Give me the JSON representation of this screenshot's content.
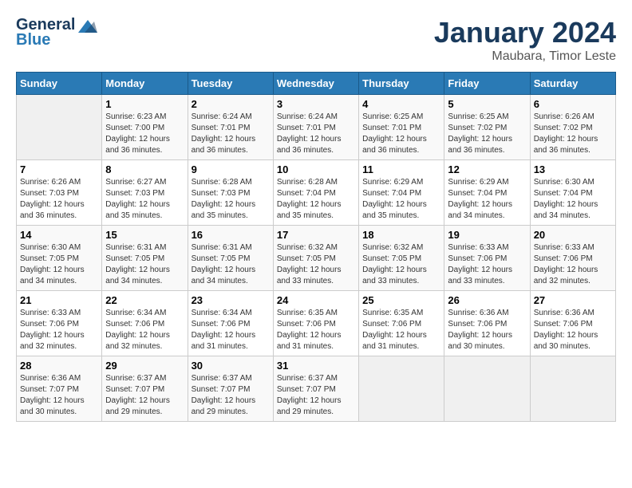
{
  "header": {
    "logo": {
      "line1": "General",
      "line2": "Blue",
      "tagline": "GeneralBlue"
    },
    "title": "January 2024",
    "subtitle": "Maubara, Timor Leste"
  },
  "columns": [
    "Sunday",
    "Monday",
    "Tuesday",
    "Wednesday",
    "Thursday",
    "Friday",
    "Saturday"
  ],
  "weeks": [
    [
      {
        "day": "",
        "info": ""
      },
      {
        "day": "1",
        "info": "Sunrise: 6:23 AM\nSunset: 7:00 PM\nDaylight: 12 hours\nand 36 minutes."
      },
      {
        "day": "2",
        "info": "Sunrise: 6:24 AM\nSunset: 7:01 PM\nDaylight: 12 hours\nand 36 minutes."
      },
      {
        "day": "3",
        "info": "Sunrise: 6:24 AM\nSunset: 7:01 PM\nDaylight: 12 hours\nand 36 minutes."
      },
      {
        "day": "4",
        "info": "Sunrise: 6:25 AM\nSunset: 7:01 PM\nDaylight: 12 hours\nand 36 minutes."
      },
      {
        "day": "5",
        "info": "Sunrise: 6:25 AM\nSunset: 7:02 PM\nDaylight: 12 hours\nand 36 minutes."
      },
      {
        "day": "6",
        "info": "Sunrise: 6:26 AM\nSunset: 7:02 PM\nDaylight: 12 hours\nand 36 minutes."
      }
    ],
    [
      {
        "day": "7",
        "info": "Sunrise: 6:26 AM\nSunset: 7:03 PM\nDaylight: 12 hours\nand 36 minutes."
      },
      {
        "day": "8",
        "info": "Sunrise: 6:27 AM\nSunset: 7:03 PM\nDaylight: 12 hours\nand 35 minutes."
      },
      {
        "day": "9",
        "info": "Sunrise: 6:28 AM\nSunset: 7:03 PM\nDaylight: 12 hours\nand 35 minutes."
      },
      {
        "day": "10",
        "info": "Sunrise: 6:28 AM\nSunset: 7:04 PM\nDaylight: 12 hours\nand 35 minutes."
      },
      {
        "day": "11",
        "info": "Sunrise: 6:29 AM\nSunset: 7:04 PM\nDaylight: 12 hours\nand 35 minutes."
      },
      {
        "day": "12",
        "info": "Sunrise: 6:29 AM\nSunset: 7:04 PM\nDaylight: 12 hours\nand 34 minutes."
      },
      {
        "day": "13",
        "info": "Sunrise: 6:30 AM\nSunset: 7:04 PM\nDaylight: 12 hours\nand 34 minutes."
      }
    ],
    [
      {
        "day": "14",
        "info": "Sunrise: 6:30 AM\nSunset: 7:05 PM\nDaylight: 12 hours\nand 34 minutes."
      },
      {
        "day": "15",
        "info": "Sunrise: 6:31 AM\nSunset: 7:05 PM\nDaylight: 12 hours\nand 34 minutes."
      },
      {
        "day": "16",
        "info": "Sunrise: 6:31 AM\nSunset: 7:05 PM\nDaylight: 12 hours\nand 34 minutes."
      },
      {
        "day": "17",
        "info": "Sunrise: 6:32 AM\nSunset: 7:05 PM\nDaylight: 12 hours\nand 33 minutes."
      },
      {
        "day": "18",
        "info": "Sunrise: 6:32 AM\nSunset: 7:05 PM\nDaylight: 12 hours\nand 33 minutes."
      },
      {
        "day": "19",
        "info": "Sunrise: 6:33 AM\nSunset: 7:06 PM\nDaylight: 12 hours\nand 33 minutes."
      },
      {
        "day": "20",
        "info": "Sunrise: 6:33 AM\nSunset: 7:06 PM\nDaylight: 12 hours\nand 32 minutes."
      }
    ],
    [
      {
        "day": "21",
        "info": "Sunrise: 6:33 AM\nSunset: 7:06 PM\nDaylight: 12 hours\nand 32 minutes."
      },
      {
        "day": "22",
        "info": "Sunrise: 6:34 AM\nSunset: 7:06 PM\nDaylight: 12 hours\nand 32 minutes."
      },
      {
        "day": "23",
        "info": "Sunrise: 6:34 AM\nSunset: 7:06 PM\nDaylight: 12 hours\nand 31 minutes."
      },
      {
        "day": "24",
        "info": "Sunrise: 6:35 AM\nSunset: 7:06 PM\nDaylight: 12 hours\nand 31 minutes."
      },
      {
        "day": "25",
        "info": "Sunrise: 6:35 AM\nSunset: 7:06 PM\nDaylight: 12 hours\nand 31 minutes."
      },
      {
        "day": "26",
        "info": "Sunrise: 6:36 AM\nSunset: 7:06 PM\nDaylight: 12 hours\nand 30 minutes."
      },
      {
        "day": "27",
        "info": "Sunrise: 6:36 AM\nSunset: 7:06 PM\nDaylight: 12 hours\nand 30 minutes."
      }
    ],
    [
      {
        "day": "28",
        "info": "Sunrise: 6:36 AM\nSunset: 7:07 PM\nDaylight: 12 hours\nand 30 minutes."
      },
      {
        "day": "29",
        "info": "Sunrise: 6:37 AM\nSunset: 7:07 PM\nDaylight: 12 hours\nand 29 minutes."
      },
      {
        "day": "30",
        "info": "Sunrise: 6:37 AM\nSunset: 7:07 PM\nDaylight: 12 hours\nand 29 minutes."
      },
      {
        "day": "31",
        "info": "Sunrise: 6:37 AM\nSunset: 7:07 PM\nDaylight: 12 hours\nand 29 minutes."
      },
      {
        "day": "",
        "info": ""
      },
      {
        "day": "",
        "info": ""
      },
      {
        "day": "",
        "info": ""
      }
    ]
  ]
}
